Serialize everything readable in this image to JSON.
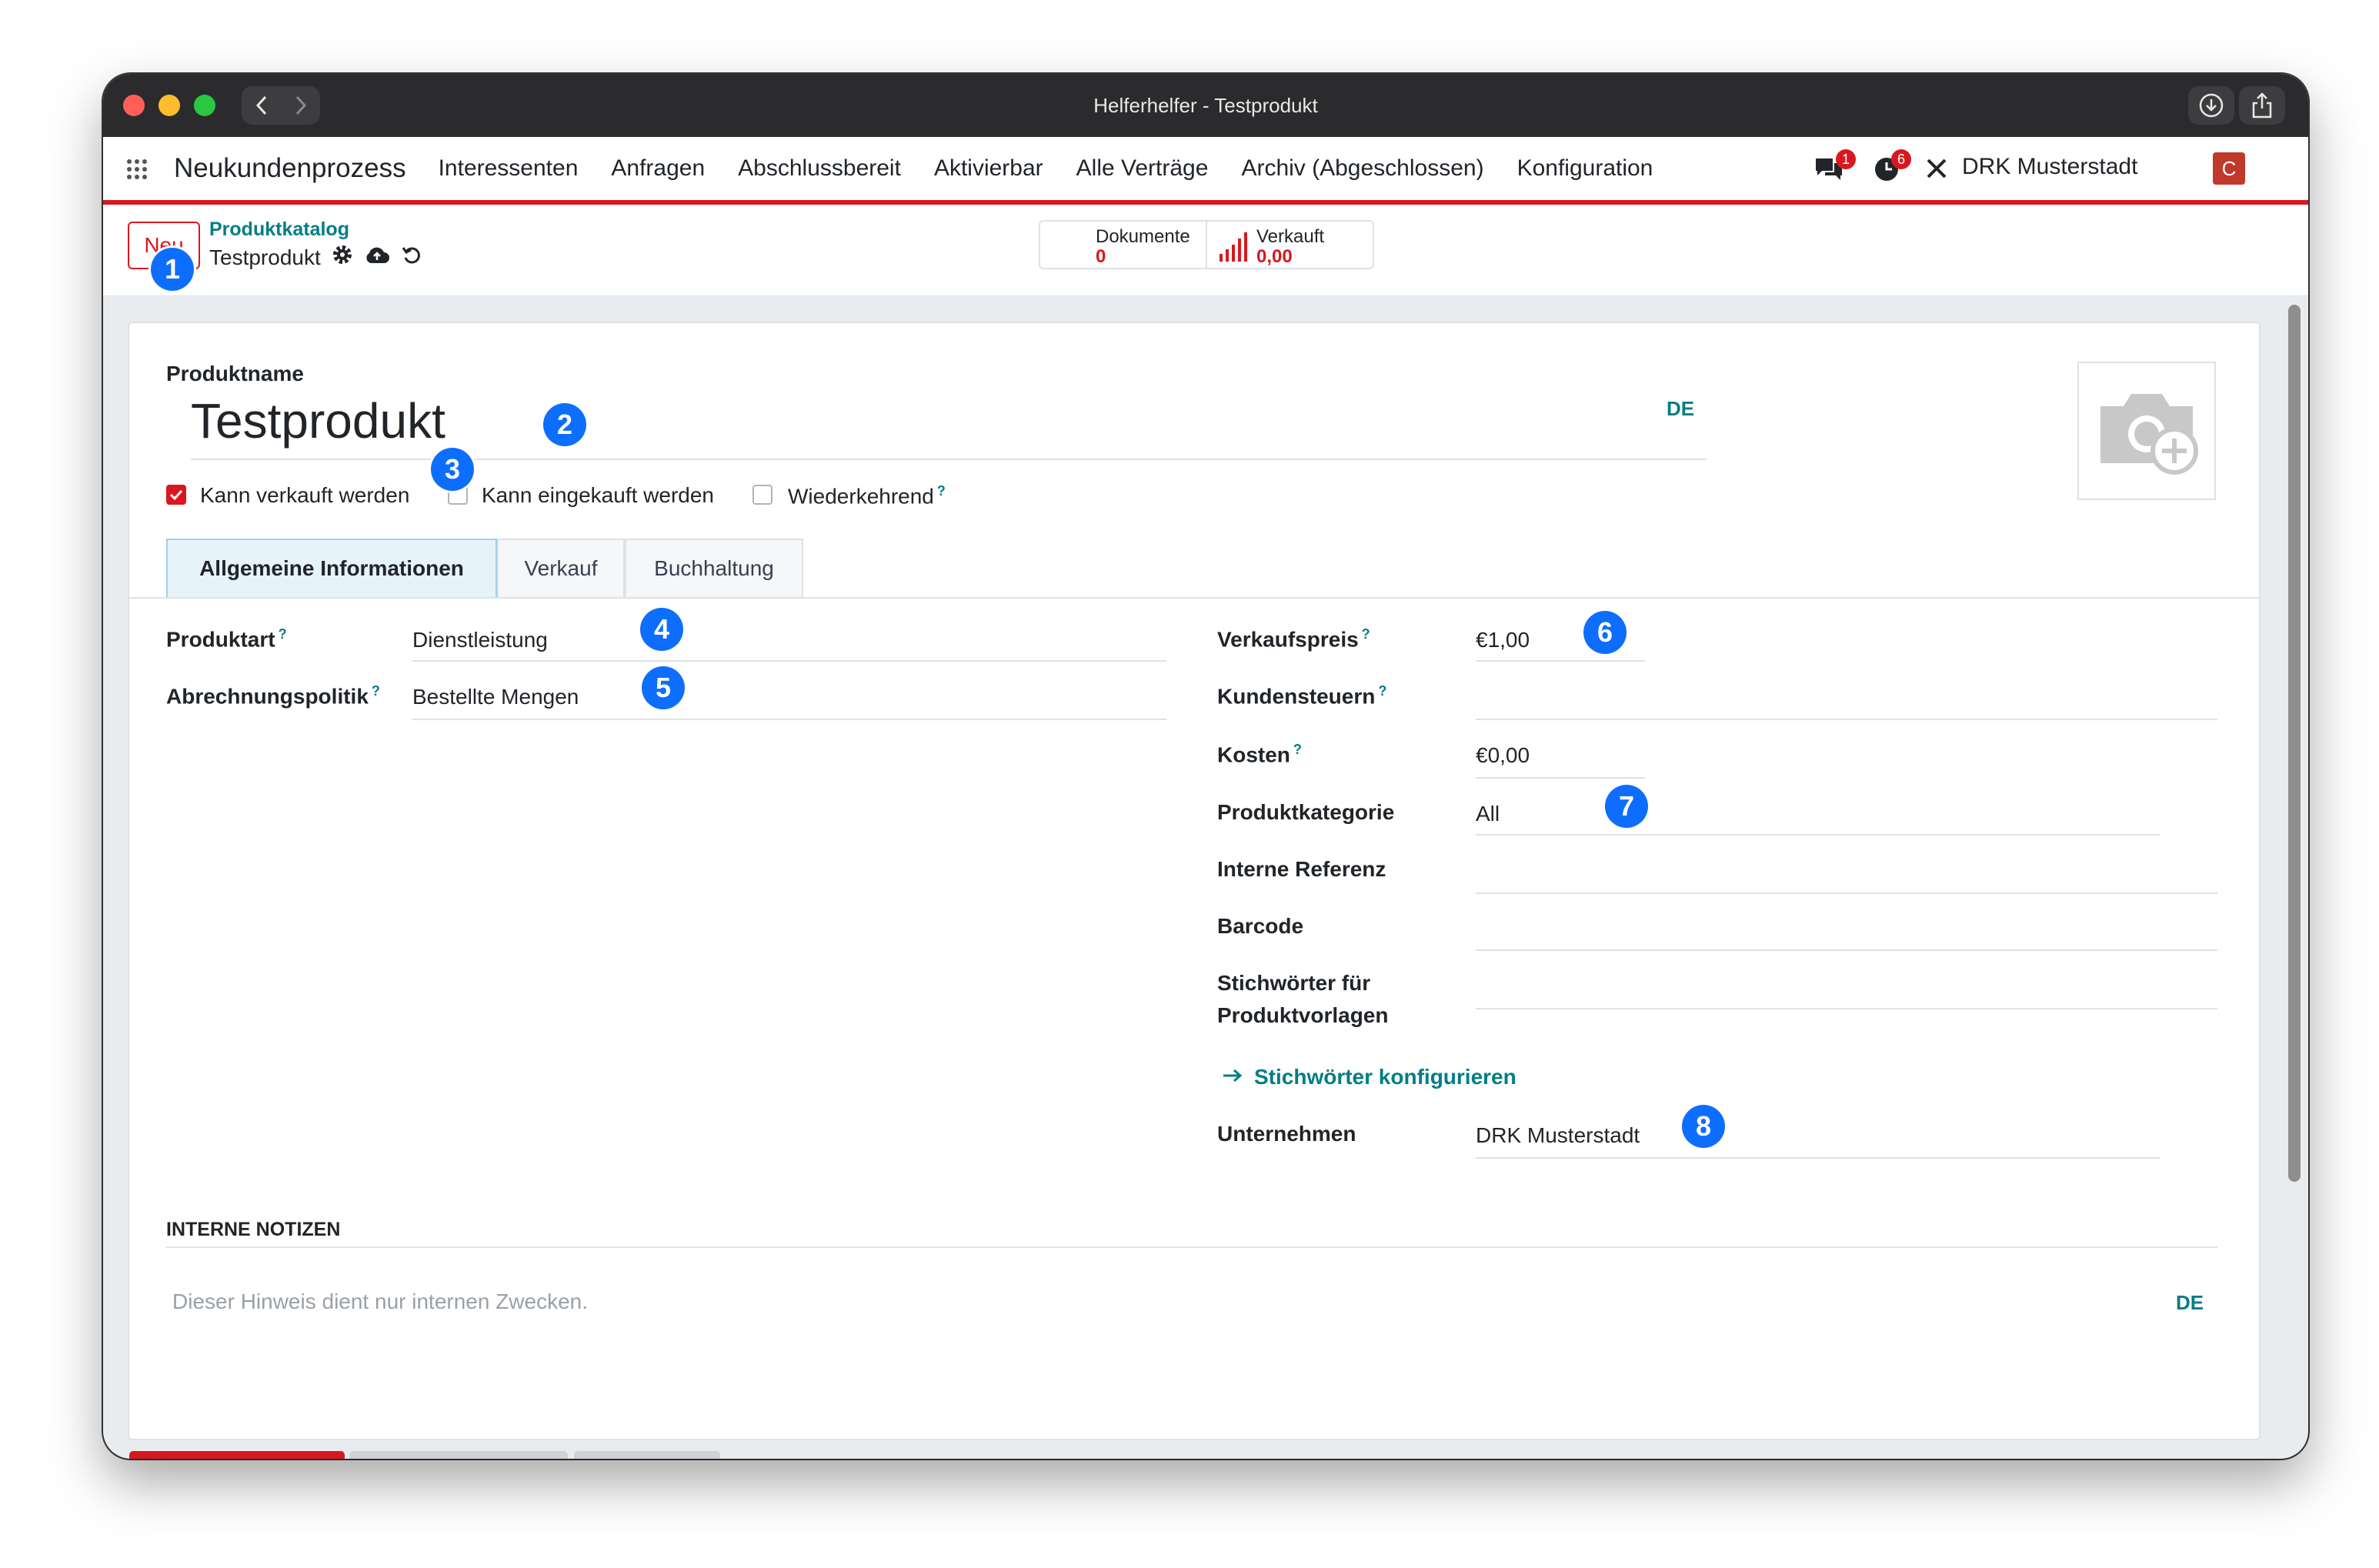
{
  "window": {
    "title": "Helferhelfer - Testprodukt"
  },
  "nav": {
    "brand": "Neukundenprozess",
    "items": [
      "Interessenten",
      "Anfragen",
      "Abschlussbereit",
      "Aktivierbar",
      "Alle Verträge",
      "Archiv (Abgeschlossen)",
      "Konfiguration"
    ],
    "messages_count": "1",
    "activities_count": "6",
    "company": "DRK Musterstadt",
    "avatar_letter": "C"
  },
  "control": {
    "new_label": "Neu",
    "breadcrumb_parent": "Produktkatalog",
    "breadcrumb_current": "Testprodukt",
    "stat_documents_label": "Dokumente",
    "stat_documents_value": "0",
    "stat_sales_label": "Verkauft",
    "stat_sales_value": "0,00"
  },
  "form": {
    "product_name_label": "Produktname",
    "product_name": "Testprodukt",
    "lang": "DE",
    "checks": [
      {
        "label": "Kann verkauft werden",
        "checked": true
      },
      {
        "label": "Kann eingekauft werden",
        "checked": false
      },
      {
        "label": "Wiederkehrend",
        "checked": false
      }
    ],
    "help": "?",
    "tabs": [
      "Allgemeine Informationen",
      "Verkauf",
      "Buchhaltung"
    ],
    "left": [
      {
        "label": "Produktart",
        "value": "Dienstleistung"
      },
      {
        "label": "Abrechnungspolitik",
        "value": "Bestellte Mengen"
      }
    ],
    "right": [
      {
        "label": "Verkaufspreis",
        "value": "€1,00"
      },
      {
        "label": "Kundensteuern",
        "value": ""
      },
      {
        "label": "Kosten",
        "value": "€0,00"
      },
      {
        "label": "Produktkategorie",
        "value": "All"
      },
      {
        "label": "Interne Referenz",
        "value": ""
      },
      {
        "label": "Barcode",
        "value": ""
      },
      {
        "label": "Stichwörter für",
        "label2": "Produktvorlagen",
        "value": ""
      }
    ],
    "configure_tags": "Stichwörter konfigurieren",
    "company_label": "Unternehmen",
    "company_value": "DRK Musterstadt",
    "notes_title": "INTERNE NOTIZEN",
    "notes_placeholder": "Dieser Hinweis dient nur internen Zwecken.",
    "notes_lang": "DE"
  },
  "markers": [
    "1",
    "2",
    "3",
    "4",
    "5",
    "6",
    "7",
    "8"
  ],
  "colors": {
    "accent": "#d7191f",
    "link": "#017e84",
    "marker": "#0d6efd"
  }
}
